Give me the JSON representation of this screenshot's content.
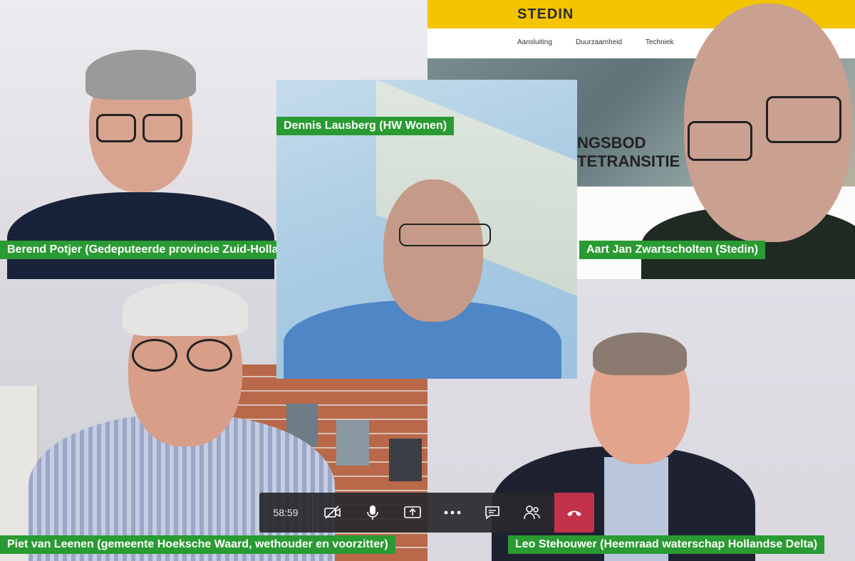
{
  "participants": {
    "berend": "Berend Potjer (Gedeputeerde provincie Zuid-Holland)",
    "dennis": "Dennis Lausberg (HW Wonen)",
    "aart": "Aart Jan Zwartscholten (Stedin)",
    "piet": "Piet van Leenen (gemeente Hoeksche Waard, wethouder en voorzitter)",
    "leo": "Leo Stehouwer (Heemraad waterschap Hollandse Delta)"
  },
  "shared_site": {
    "logo": "STEDIN",
    "nav": [
      "Aansluiting",
      "Duurzaamheid",
      "Techniek"
    ],
    "hero_line1": "NGSBOD",
    "hero_line2": "TETRANSITIE"
  },
  "toolbar": {
    "timer": "58:59",
    "icons": [
      "camera-off-icon",
      "microphone-icon",
      "share-screen-icon",
      "more-icon",
      "chat-icon",
      "participants-icon",
      "hangup-icon"
    ]
  },
  "colors": {
    "name_tag": "#2a9a32",
    "hangup": "#c4314b",
    "site_brand": "#f5c400"
  }
}
